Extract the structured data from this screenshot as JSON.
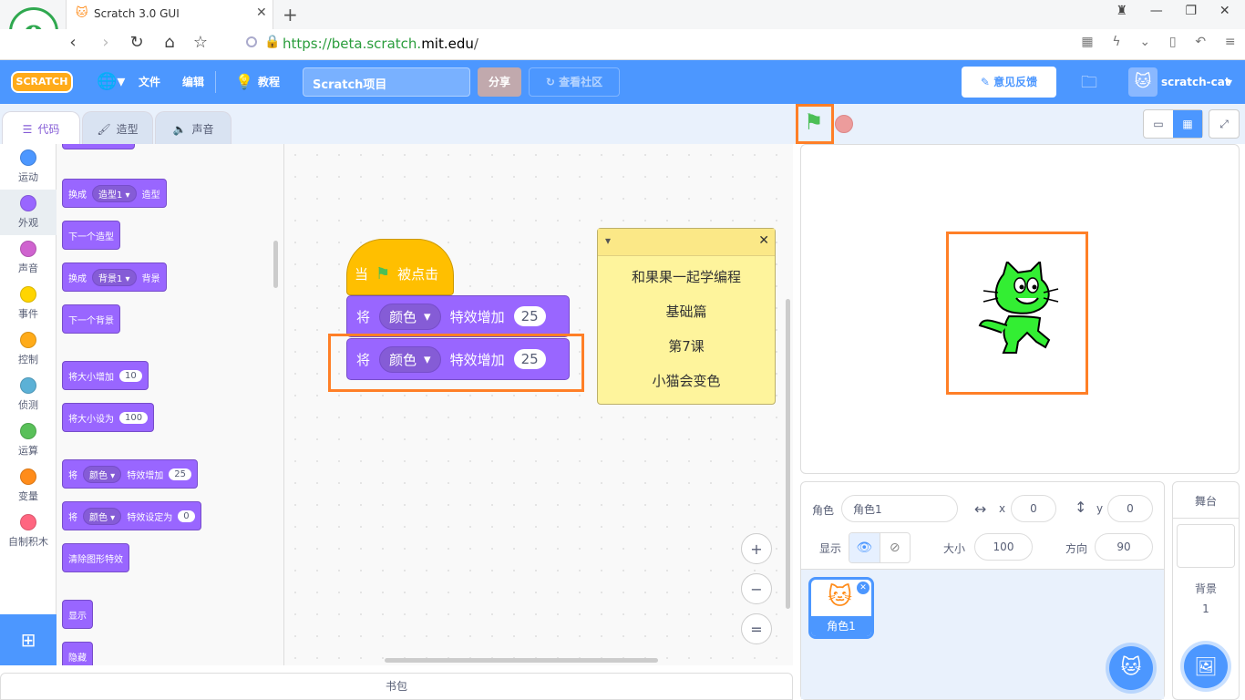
{
  "browser": {
    "tab_title": "Scratch 3.0 GUI",
    "url_prefix": "https://beta.scratch.",
    "url_domain": "mit.edu",
    "url_suffix": "/",
    "logo_letter": "e"
  },
  "menu": {
    "logo": "SCRATCH",
    "file": "文件",
    "edit": "编辑",
    "tutorials": "教程",
    "project_title": "Scratch项目",
    "share": "分享",
    "community": "查看社区",
    "feedback": "意见反馈",
    "username": "scratch-cat"
  },
  "tabs": {
    "code": "代码",
    "costumes": "造型",
    "sounds": "声音"
  },
  "categories": [
    {
      "label": "运动",
      "color": "#4c97ff"
    },
    {
      "label": "外观",
      "color": "#9966ff"
    },
    {
      "label": "声音",
      "color": "#cf63cf"
    },
    {
      "label": "事件",
      "color": "#ffd500"
    },
    {
      "label": "控制",
      "color": "#ffab19"
    },
    {
      "label": "侦测",
      "color": "#5cb1d6"
    },
    {
      "label": "运算",
      "color": "#59c059"
    },
    {
      "label": "变量",
      "color": "#ff8c1a"
    },
    {
      "label": "自制积木",
      "color": "#ff6680"
    }
  ],
  "palette": {
    "switch_costume": "换成",
    "costume_value": "造型1",
    "costume_word": "造型",
    "next_costume": "下一个造型",
    "switch_backdrop": "换成",
    "backdrop_value": "背景1",
    "backdrop_word": "背景",
    "next_backdrop": "下一个背景",
    "change_size": "将大小增加",
    "change_size_value": "10",
    "set_size": "将大小设为",
    "set_size_value": "100",
    "change_effect_prefix": "将",
    "effect_value": "颜色",
    "change_effect_suffix": "特效增加",
    "change_effect_value": "25",
    "set_effect_prefix": "将",
    "set_effect_suffix": "特效设定为",
    "set_effect_value": "0",
    "clear_effects": "清除图形特效",
    "show": "显示",
    "hide": "隐藏"
  },
  "script": {
    "hat_prefix": "当",
    "hat_suffix": "被点击",
    "block1_prefix": "将",
    "block1_dropdown": "颜色",
    "block1_suffix": "特效增加",
    "block1_value": "25",
    "block2_prefix": "将",
    "block2_dropdown": "颜色",
    "block2_suffix": "特效增加",
    "block2_value": "25"
  },
  "comment": {
    "lines": [
      "和果果一起学编程",
      "基础篇",
      "第7课",
      "小猫会变色"
    ]
  },
  "zoom": {
    "in": "+",
    "out": "−",
    "reset": "="
  },
  "backpack": "书包",
  "sprite_info": {
    "sprite_label": "角色",
    "sprite_name": "角色1",
    "x_label": "x",
    "x_value": "0",
    "y_label": "y",
    "y_value": "0",
    "show_label": "显示",
    "size_label": "大小",
    "size_value": "100",
    "direction_label": "方向",
    "direction_value": "90"
  },
  "sprite_list": [
    {
      "name": "角色1"
    }
  ],
  "stage_pane": {
    "title": "舞台",
    "backdrops_label": "背景",
    "backdrops_count": "1"
  },
  "colors": {
    "menu_blue": "#4c97ff",
    "looks_purple": "#9966ff",
    "events_yellow": "#ffbf00",
    "highlight_orange": "#ff7f27",
    "cat_green": "#33ee33"
  }
}
